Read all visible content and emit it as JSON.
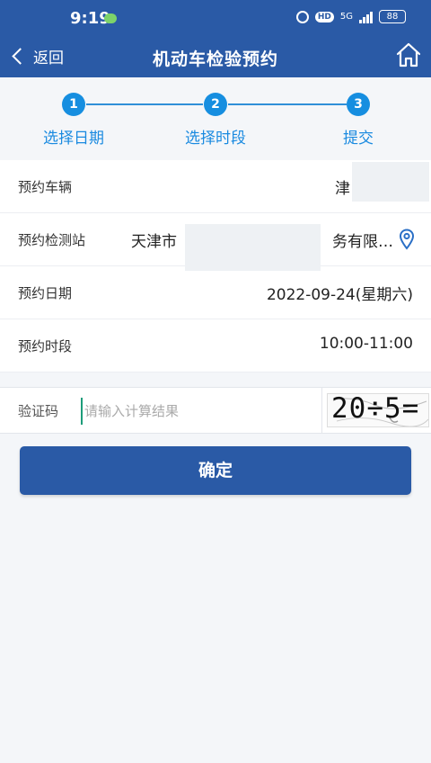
{
  "status_bar": {
    "time": "9:19",
    "network": "5G",
    "hd": "HD",
    "battery": "88"
  },
  "nav": {
    "back_label": "返回",
    "title": "机动车检验预约"
  },
  "steps": [
    {
      "number": "1",
      "label": "选择日期"
    },
    {
      "number": "2",
      "label": "选择时段"
    },
    {
      "number": "3",
      "label": "提交"
    }
  ],
  "form": {
    "vehicle": {
      "label": "预约车辆",
      "value": "津"
    },
    "station": {
      "label": "预约检测站",
      "value_prefix": "天津市",
      "value_suffix": "务有限…"
    },
    "date": {
      "label": "预约日期",
      "value": "2022-09-24(星期六)"
    },
    "time_slot": {
      "label": "预约时段",
      "value": "10:00-11:00"
    }
  },
  "captcha": {
    "label": "验证码",
    "placeholder": "请输入计算结果",
    "value": "",
    "image_text": "20÷5="
  },
  "confirm_button": {
    "label": "确定"
  },
  "colors": {
    "primary": "#2a5aa6",
    "step_accent": "#168ee0",
    "background": "#f4f6f9"
  }
}
